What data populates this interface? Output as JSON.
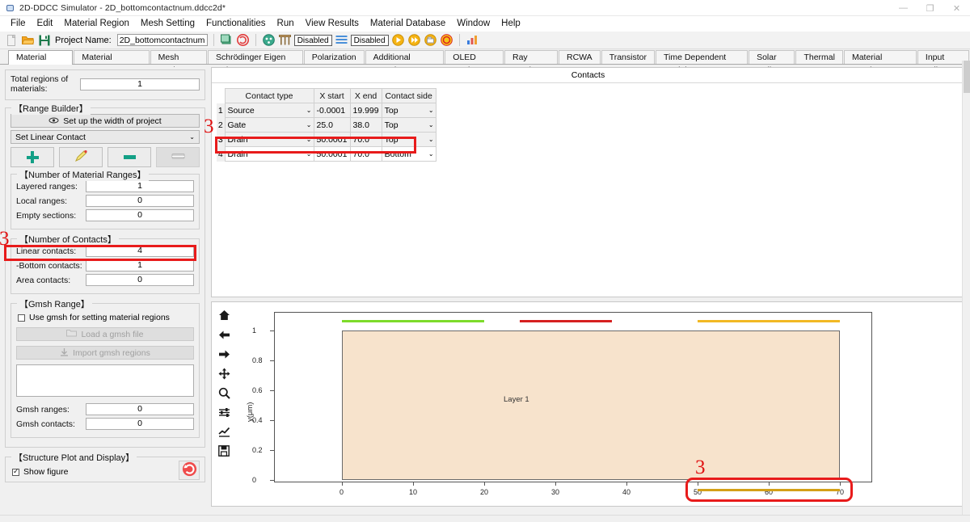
{
  "window": {
    "title": "2D-DDCC Simulator - 2D_bottomcontactnum.ddcc2d*",
    "app_icon": "simulator-icon",
    "minimize": "—",
    "maximize": "❐",
    "close": "✕"
  },
  "menu": {
    "items": [
      "File",
      "Edit",
      "Material Region",
      "Mesh Setting",
      "Functionalities",
      "Run",
      "View Results",
      "Material Database",
      "Window",
      "Help"
    ]
  },
  "toolbar": {
    "new_icon": "new-file-icon",
    "open_icon": "open-folder-icon",
    "save_icon": "save-icon",
    "project_label": "Project Name:",
    "project_value": "2D_bottomcontactnum",
    "refresh_icon": "refresh-icon",
    "sync_icon": "sync-icon",
    "structure_icon": "structure-icon",
    "mesh_icon": "mesh-icon",
    "mesh_state": "Disabled",
    "layers_icon": "layers-icon",
    "layers_state": "Disabled",
    "run_icon": "run-icon",
    "run_all_icon": "run-all-icon",
    "export_icon": "export-icon",
    "stop_icon": "stop-icon",
    "chart_icon": "chart-icon"
  },
  "tabs": {
    "active": "Material Region",
    "items": [
      "Material Region",
      "Material Parameter",
      "Mesh Setting",
      "Schrödinger Eigen Solver",
      "Polarization",
      "Additional Functions",
      "OLED Setting",
      "Ray Tracing",
      "RCWA",
      "Transistor",
      "Time Dependent Module",
      "Solar Cell",
      "Thermal",
      "Material Database",
      "Input Editor"
    ]
  },
  "sidebar": {
    "total_regions_label": "Total regions of materials:",
    "total_regions_value": "1",
    "range_builder_title": "【Range Builder】",
    "setup_width_label": "Set up the width of project",
    "setup_width_icon": "width-icon",
    "contact_mode_value": "Set Linear Contact",
    "contact_mode_caret": "chevron-down-icon",
    "action_buttons": [
      {
        "name": "add-range-button",
        "icon": "plus-icon",
        "enabled": true
      },
      {
        "name": "edit-range-button",
        "icon": "pencil-icon",
        "enabled": true
      },
      {
        "name": "remove-range-button",
        "icon": "minus-icon",
        "enabled": true
      },
      {
        "name": "clear-range-button",
        "icon": "eraser-icon",
        "enabled": false
      }
    ],
    "material_ranges_title": "【Number of Material Ranges】",
    "layered_ranges_label": "Layered ranges:",
    "layered_ranges_value": "1",
    "local_ranges_label": "Local ranges:",
    "local_ranges_value": "0",
    "empty_sections_label": "Empty sections:",
    "empty_sections_value": "0",
    "contacts_title": "【Number of Contacts】",
    "linear_contacts_label": "Linear contacts:",
    "linear_contacts_value": "4",
    "bottom_contacts_label": "-Bottom contacts:",
    "bottom_contacts_value": "1",
    "area_contacts_label": "Area contacts:",
    "area_contacts_value": "0",
    "gmsh_title": "【Gmsh Range】",
    "gmsh_checkbox_label": "Use gmsh for setting material regions",
    "gmsh_checkbox_checked": false,
    "load_gmsh_label": "Load a gmsh file",
    "load_gmsh_icon": "folder-icon",
    "import_gmsh_label": "Import gmsh regions",
    "import_gmsh_icon": "download-icon",
    "gmsh_ranges_label": "Gmsh ranges:",
    "gmsh_ranges_value": "0",
    "gmsh_contacts_label": "Gmsh contacts:",
    "gmsh_contacts_value": "0",
    "structure_plot_title": "【Structure Plot and Display】",
    "show_figure_label": "Show figure",
    "show_figure_checked": true,
    "refresh_plot_icon": "refresh-plot-icon"
  },
  "contacts": {
    "caption": "Contacts",
    "columns": [
      "Contact type",
      "X start",
      "X end",
      "Contact side"
    ],
    "rows": [
      {
        "num": "1",
        "type": "Source",
        "x_start": "-0.0001",
        "x_end": "19.999",
        "side": "Top",
        "selected": false
      },
      {
        "num": "2",
        "type": "Gate",
        "x_start": "25.0",
        "x_end": "38.0",
        "side": "Top",
        "selected": false
      },
      {
        "num": "3",
        "type": "Drain",
        "x_start": "50.0001",
        "x_end": "70.0",
        "side": "Top",
        "selected": false
      },
      {
        "num": "4",
        "type": "Drain",
        "x_start": "50.0001",
        "x_end": "70.0",
        "side": "Bottom",
        "selected": true
      }
    ]
  },
  "annotations": {
    "marker_sidebar": "3",
    "marker_table": "3",
    "marker_plot": "3",
    "highlight_color": "#e81b1b"
  },
  "plot_toolbar": {
    "items": [
      "home-icon",
      "back-arrow-icon",
      "forward-arrow-icon",
      "pan-icon",
      "zoom-icon",
      "configure-subplots-icon",
      "edit-curve-icon",
      "save-figure-icon"
    ]
  },
  "chart_data": {
    "type": "area",
    "title": "",
    "xlabel": "",
    "ylabel": "y(μm)",
    "xlim": [
      -3,
      73
    ],
    "ylim": [
      -0.12,
      1.08
    ],
    "xticks": [
      0,
      10,
      20,
      30,
      40,
      50,
      60,
      70
    ],
    "yticks": [
      0.0,
      0.2,
      0.4,
      0.6,
      0.8,
      1.0
    ],
    "grid": false,
    "regions": [
      {
        "name": "Layer 1",
        "x0": 0,
        "x1": 70,
        "y0": 0.0,
        "y1": 1.0,
        "color": "#f7e3cc",
        "edge": "#6a6a6a"
      }
    ],
    "contacts": [
      {
        "name": "Source",
        "x0": 0,
        "x1": 20,
        "y": 1.05,
        "side": "Top",
        "color": "#7ddb2a"
      },
      {
        "name": "Gate",
        "x0": 25,
        "x1": 38,
        "y": 1.05,
        "side": "Top",
        "color": "#d62020"
      },
      {
        "name": "Drain",
        "x0": 50,
        "x1": 70,
        "y": 1.05,
        "side": "Top",
        "color": "#f2b824"
      },
      {
        "name": "Drain",
        "x0": 50,
        "x1": 70,
        "y": -0.06,
        "side": "Bottom",
        "color": "#d4a017"
      }
    ]
  }
}
